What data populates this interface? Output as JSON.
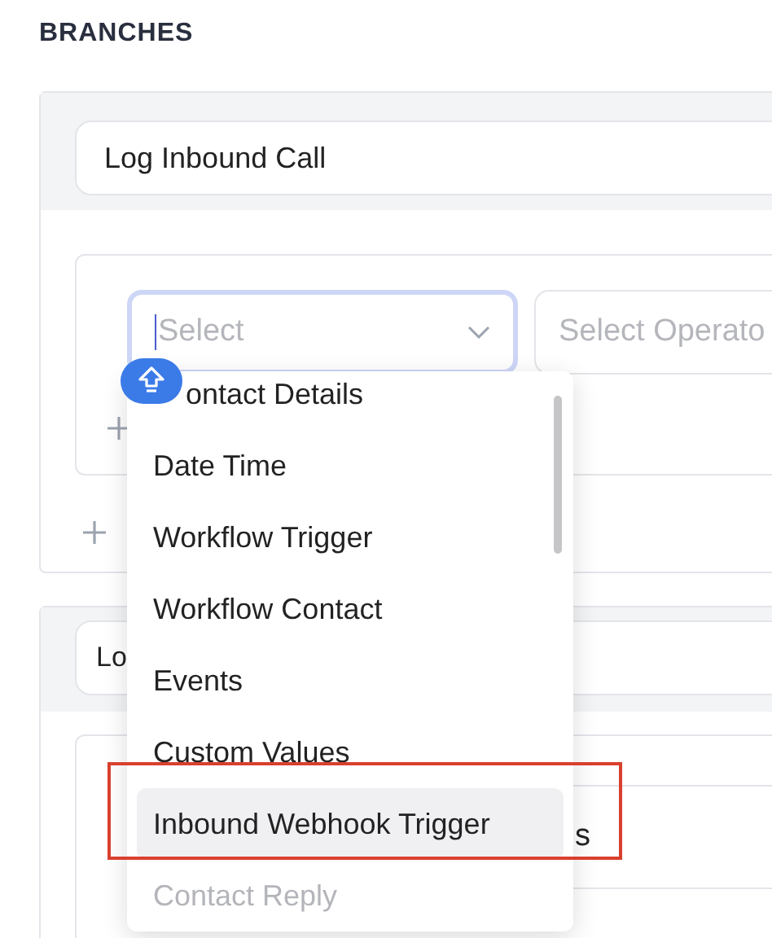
{
  "heading": "BRANCHES",
  "branches": [
    {
      "name": "Log Inbound Call",
      "condition": {
        "field_placeholder": "Select",
        "field_focused": true,
        "operator_placeholder": "Select Operato"
      }
    },
    {
      "name": "Lo",
      "condition": {
        "value_fragment": "s"
      }
    }
  ],
  "dropdown": {
    "items": [
      {
        "label": "ontact Details",
        "highlighted": false,
        "disabled": false
      },
      {
        "label": "Date Time",
        "highlighted": false,
        "disabled": false
      },
      {
        "label": "Workflow Trigger",
        "highlighted": false,
        "disabled": false
      },
      {
        "label": "Workflow Contact",
        "highlighted": false,
        "disabled": false
      },
      {
        "label": "Events",
        "highlighted": false,
        "disabled": false
      },
      {
        "label": "Custom Values",
        "highlighted": false,
        "disabled": false
      },
      {
        "label": "Inbound Webhook Trigger",
        "highlighted": true,
        "disabled": false
      },
      {
        "label": "Contact Reply",
        "highlighted": false,
        "disabled": true
      }
    ]
  }
}
